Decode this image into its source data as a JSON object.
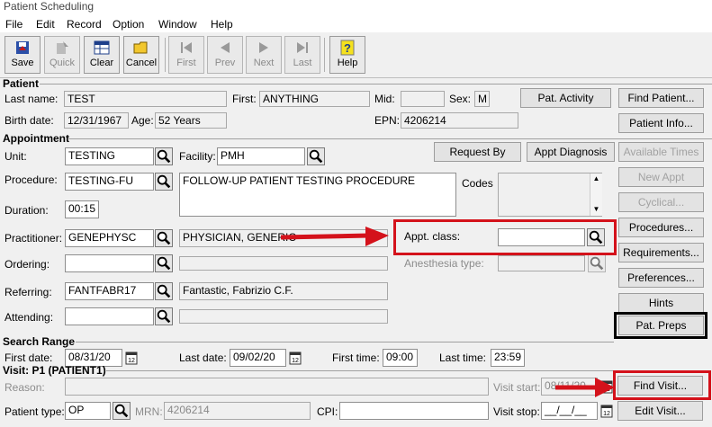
{
  "window": {
    "title": "Patient Scheduling"
  },
  "menu": [
    "File",
    "Edit",
    "Record",
    "Option",
    "Window",
    "Help"
  ],
  "toolbar": {
    "save": "Save",
    "quick": "Quick",
    "clear": "Clear",
    "cancel": "Cancel",
    "first": "First",
    "prev": "Prev",
    "next": "Next",
    "last": "Last",
    "help": "Help"
  },
  "patient": {
    "section": "Patient",
    "last_name_label": "Last name:",
    "last_name": "TEST",
    "first_label": "First:",
    "first": "ANYTHING",
    "mid_label": "Mid:",
    "mid": "",
    "sex_label": "Sex:",
    "sex": "M",
    "pat_activity_button": "Pat. Activity",
    "find_patient_button": "Find Patient...",
    "birth_date_label": "Birth date:",
    "birth_date": "12/31/1967",
    "age_label": "Age:",
    "age": "52 Years",
    "epn_label": "EPN:",
    "epn": "4206214",
    "patient_info_button": "Patient Info..."
  },
  "appointment": {
    "section": "Appointment",
    "unit_label": "Unit:",
    "unit": "TESTING",
    "facility_label": "Facility:",
    "facility": "PMH",
    "request_by_button": "Request By",
    "appt_diagnosis_button": "Appt Diagnosis",
    "available_times_button": "Available Times",
    "procedure_label": "Procedure:",
    "procedure": "TESTING-FU",
    "procedure_desc": "FOLLOW-UP PATIENT TESTING PROCEDURE",
    "codes_label": "Codes",
    "new_appt_button": "New Appt",
    "duration_label": "Duration:",
    "duration": "00:15",
    "cyclical_button": "Cyclical...",
    "practitioner_label": "Practitioner:",
    "practitioner": "GENEPHYSC",
    "practitioner_name": "PHYSICIAN, GENERIC",
    "appt_class_label": "Appt. class:",
    "appt_class": "",
    "procedures_button": "Procedures...",
    "ordering_label": "Ordering:",
    "ordering": "",
    "anesthesia_label": "Anesthesia type:",
    "anesthesia": "",
    "requirements_button": "Requirements...",
    "referring_label": "Referring:",
    "referring": "FANTFABR17",
    "referring_name": "Fantastic, Fabrizio C.F.",
    "preferences_button": "Preferences...",
    "hints_button": "Hints",
    "attending_label": "Attending:",
    "attending": "",
    "pat_preps_button": "Pat. Preps"
  },
  "search_range": {
    "section": "Search Range",
    "first_date_label": "First date:",
    "first_date": "08/31/20",
    "last_date_label": "Last date:",
    "last_date": "09/02/20",
    "first_time_label": "First time:",
    "first_time": "09:00",
    "last_time_label": "Last time:",
    "last_time": "23:59"
  },
  "visit": {
    "section": "Visit: P1 (PATIENT1)",
    "reason_label": "Reason:",
    "reason": "",
    "visit_start_label": "Visit start:",
    "visit_start": "08/11/20",
    "find_visit_button": "Find Visit...",
    "patient_type_label": "Patient type:",
    "patient_type": "OP",
    "mrn_label": "MRN:",
    "mrn": "4206214",
    "cpi_label": "CPI:",
    "cpi": "",
    "visit_stop_label": "Visit stop:",
    "visit_stop": "__/__/__",
    "edit_visit_button": "Edit Visit..."
  },
  "colors": {
    "annotation_red": "#d4121b",
    "window_bg": "#f0f0f0"
  }
}
